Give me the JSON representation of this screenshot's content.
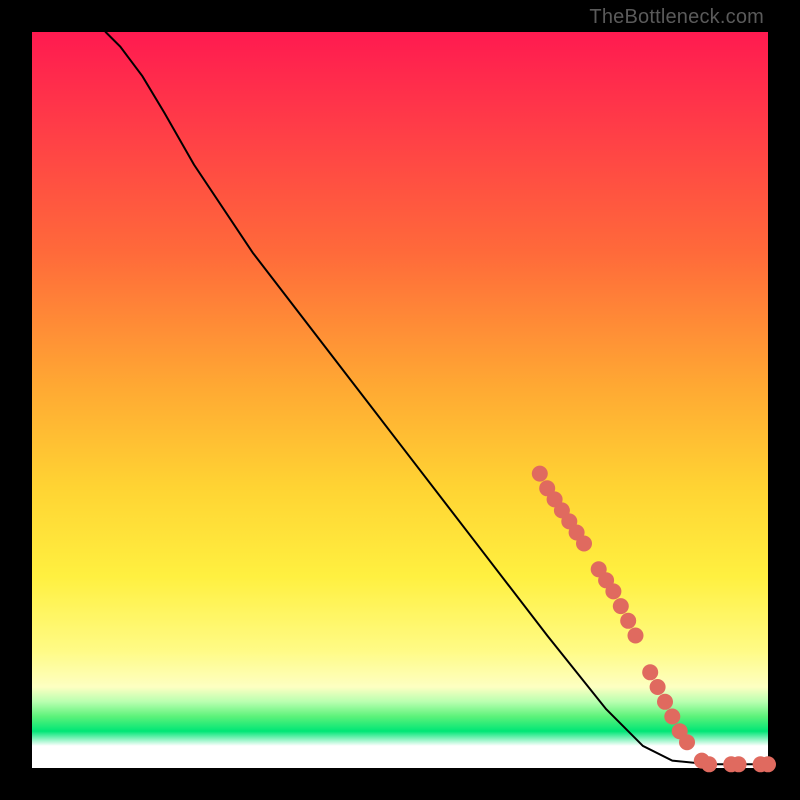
{
  "watermark": "TheBottleneck.com",
  "colors": {
    "dot": "#e06a5f",
    "curve": "#000000",
    "bg_black": "#000000"
  },
  "chart_data": {
    "type": "line",
    "title": "",
    "xlabel": "",
    "ylabel": "",
    "xlim": [
      0,
      100
    ],
    "ylim": [
      0,
      100
    ],
    "grid": false,
    "legend": false,
    "curve": [
      {
        "x": 10,
        "y": 100
      },
      {
        "x": 12,
        "y": 98
      },
      {
        "x": 15,
        "y": 94
      },
      {
        "x": 18,
        "y": 89
      },
      {
        "x": 22,
        "y": 82
      },
      {
        "x": 30,
        "y": 70
      },
      {
        "x": 40,
        "y": 57
      },
      {
        "x": 50,
        "y": 44
      },
      {
        "x": 60,
        "y": 31
      },
      {
        "x": 70,
        "y": 18
      },
      {
        "x": 78,
        "y": 8
      },
      {
        "x": 83,
        "y": 3
      },
      {
        "x": 87,
        "y": 1
      },
      {
        "x": 92,
        "y": 0.5
      },
      {
        "x": 100,
        "y": 0.5
      }
    ],
    "series": [
      {
        "name": "highlighted-points",
        "points": [
          {
            "x": 69,
            "y": 40
          },
          {
            "x": 70,
            "y": 38
          },
          {
            "x": 71,
            "y": 36.5
          },
          {
            "x": 72,
            "y": 35
          },
          {
            "x": 73,
            "y": 33.5
          },
          {
            "x": 74,
            "y": 32
          },
          {
            "x": 75,
            "y": 30.5
          },
          {
            "x": 77,
            "y": 27
          },
          {
            "x": 78,
            "y": 25.5
          },
          {
            "x": 79,
            "y": 24
          },
          {
            "x": 80,
            "y": 22
          },
          {
            "x": 81,
            "y": 20
          },
          {
            "x": 82,
            "y": 18
          },
          {
            "x": 84,
            "y": 13
          },
          {
            "x": 85,
            "y": 11
          },
          {
            "x": 86,
            "y": 9
          },
          {
            "x": 87,
            "y": 7
          },
          {
            "x": 88,
            "y": 5
          },
          {
            "x": 89,
            "y": 3.5
          },
          {
            "x": 91,
            "y": 1
          },
          {
            "x": 92,
            "y": 0.5
          },
          {
            "x": 95,
            "y": 0.5
          },
          {
            "x": 96,
            "y": 0.5
          },
          {
            "x": 99,
            "y": 0.5
          },
          {
            "x": 100,
            "y": 0.5
          }
        ]
      }
    ]
  }
}
